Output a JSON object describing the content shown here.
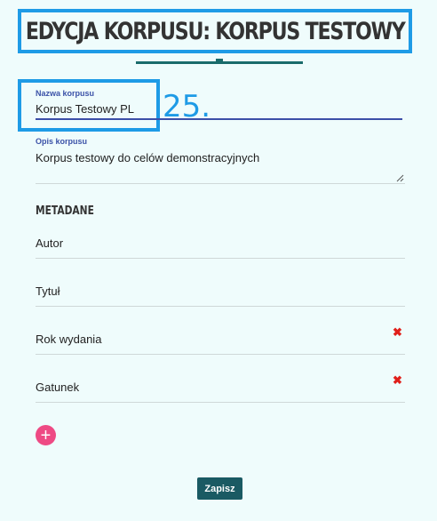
{
  "page": {
    "title": "EDYCJA KORPUSU: KORPUS TESTOWY"
  },
  "form": {
    "name_label": "Nazwa korpusu",
    "name_value": "Korpus Testowy PL",
    "description_label": "Opis korpusu",
    "description_value": "Korpus testowy do celów demonstracyjnych"
  },
  "annotation": {
    "number": "25."
  },
  "metadata": {
    "section_title": "METADANE",
    "fields": [
      {
        "label": "Autor",
        "removable": false
      },
      {
        "label": "Tytuł",
        "removable": false
      },
      {
        "label": "Rok wydania",
        "removable": true
      },
      {
        "label": "Gatunek",
        "removable": true
      }
    ],
    "remove_glyph": "✖",
    "add_glyph": "+"
  },
  "actions": {
    "save_label": "Zapisz"
  },
  "colors": {
    "background": "#effcfc",
    "highlight": "#1e9be6",
    "accent": "#1a6b6b",
    "input_active": "#3b4fa8",
    "remove": "#e0201b",
    "add": "#ee4a84",
    "save": "#1a5a63"
  }
}
